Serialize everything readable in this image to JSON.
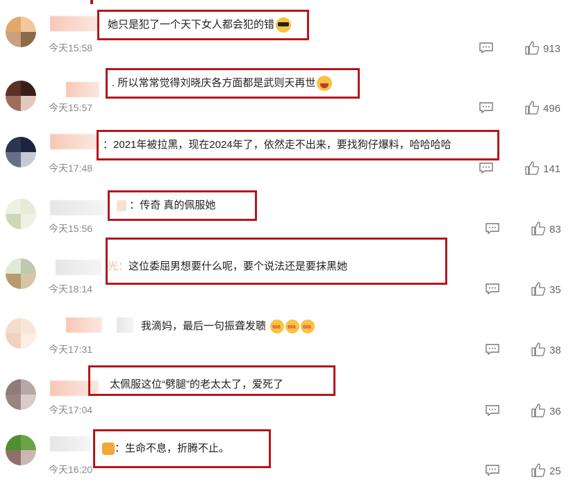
{
  "comments": [
    {
      "text": "她只是犯了一个天下女人都会犯的错",
      "emoji": "glasses",
      "time": "今天15:58",
      "likes": "913",
      "avatar": [
        "#e2a869",
        "#f2c79b",
        "#caa07e",
        "#8b6a4a"
      ]
    },
    {
      "text": "所以常常觉得刘晓庆各方面都是武则天再世",
      "emoji": "laugh",
      "prefix": ".",
      "time": "今天15:57",
      "likes": "496",
      "avatar": [
        "#5a3027",
        "#3a1f18",
        "#a06d5c",
        "#e2c9c0"
      ]
    },
    {
      "text": "2021年被拉黑，现在2024年了，依然走不出来，要找狗仔爆料，哈哈哈哈",
      "prefix": "：",
      "time": "今天17:48",
      "likes": "141",
      "avatar": [
        "#2d3550",
        "#1e2440",
        "#6a6f88",
        "#c7c9d6"
      ]
    },
    {
      "text": "传奇 真的佩服她",
      "prefix": "：",
      "time": "今天15:56",
      "likes": "83",
      "avatar": [
        "#eef0e6",
        "#e6ead6",
        "#cfd8b5",
        "#eef1e4"
      ]
    },
    {
      "text": "这位委屈男想要什么呢，要个说法还是要抹黑她",
      "prefix": "光：",
      "time": "今天18:14",
      "likes": "35",
      "avatar": [
        "#dfe9d6",
        "#bfc9b0",
        "#b89a6f",
        "#d7c6a5"
      ]
    },
    {
      "text": "我滴妈，最后一句振聋发聩",
      "emoji6": [
        "666",
        "666",
        "666"
      ],
      "time": "今天17:31",
      "likes": "38",
      "avatar": [
        "#f5dccb",
        "#f9e6d8",
        "#f0d2bd",
        "#fbeee5"
      ]
    },
    {
      "text": "太佩服这位“劈腿”的老太太了，爱死了",
      "time": "今天17:04",
      "likes": "36",
      "avatar": [
        "#8f7c78",
        "#b8a7a3",
        "#9a8582",
        "#d8cbc8"
      ]
    },
    {
      "text": "生命不息，折腾不止。",
      "prefix": "：",
      "time": "今天16:20",
      "likes": "25",
      "avatar": [
        "#4f8f2f",
        "#6aa447",
        "#8e6f6a",
        "#c9b7b3"
      ]
    }
  ],
  "icons": {
    "comment": "comment-icon",
    "like": "thumbs-up-icon"
  },
  "colors": {
    "highlight_border": "#b5161b",
    "time": "#8a8a8a"
  }
}
